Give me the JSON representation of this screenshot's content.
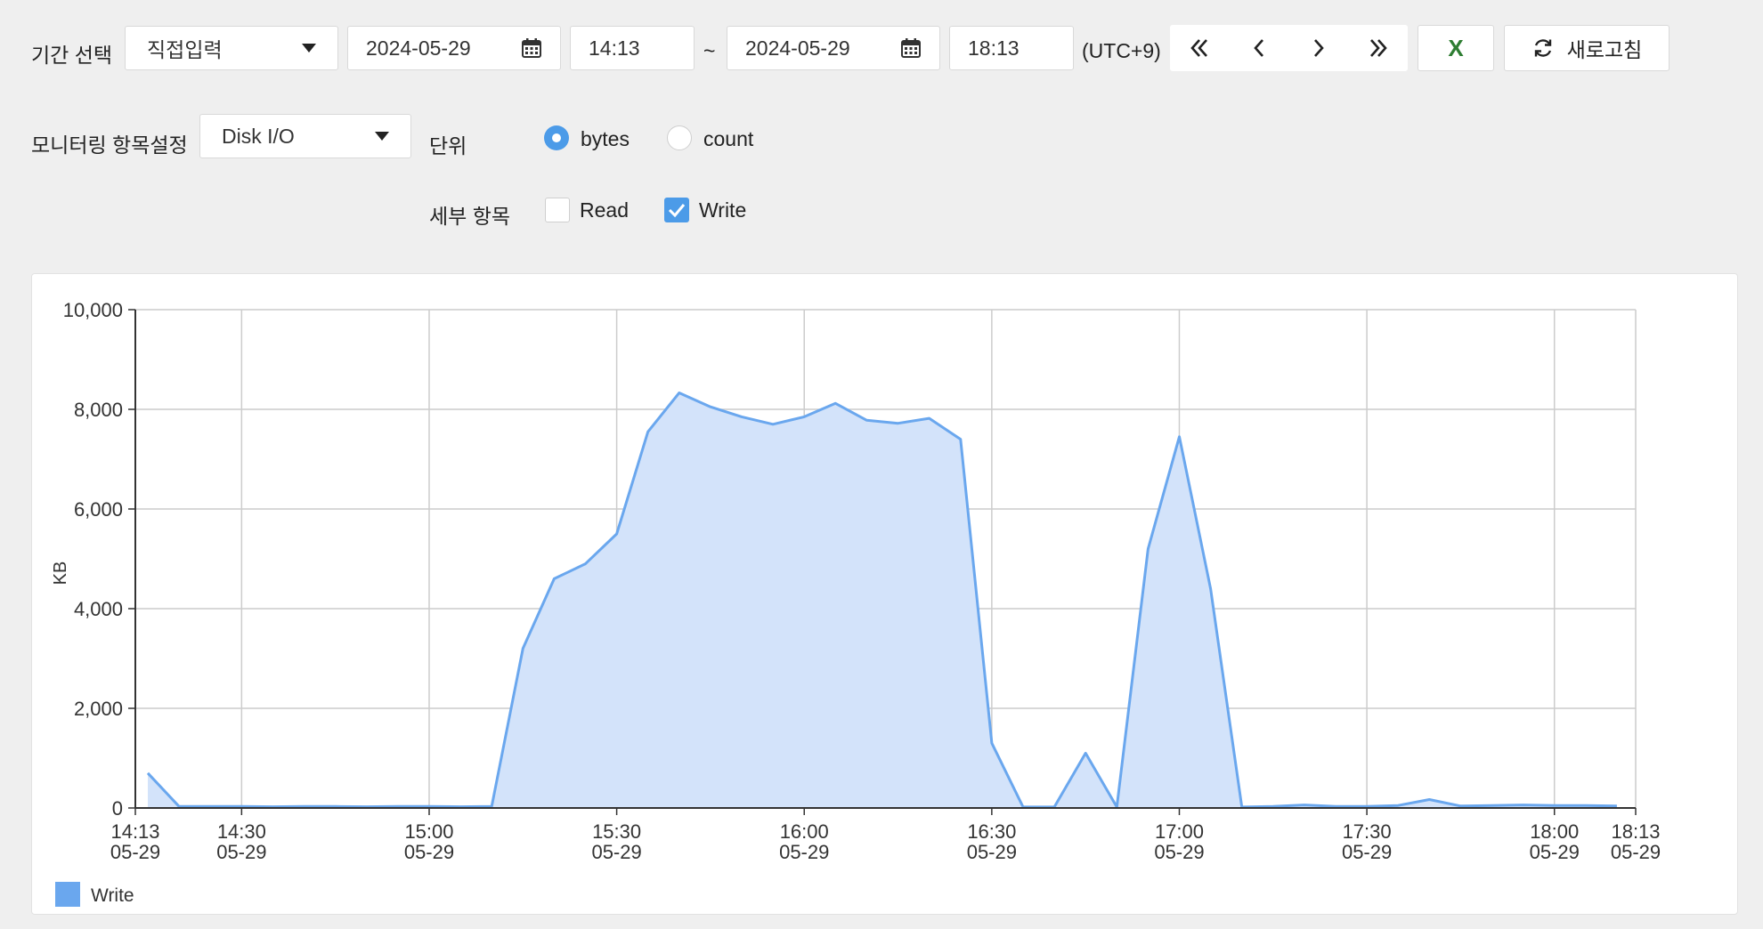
{
  "period": {
    "label": "기간 선택",
    "mode": "직접입력",
    "start_date": "2024-05-29",
    "start_time": "14:13",
    "separator": "~",
    "end_date": "2024-05-29",
    "end_time": "18:13",
    "timezone": "(UTC+9)"
  },
  "nav": [
    "first-icon",
    "prev-icon",
    "next-icon",
    "last-icon"
  ],
  "excel": {
    "label": "X",
    "color": "#2e7d32"
  },
  "refresh": {
    "label": "새로고침",
    "icon": "refresh-icon"
  },
  "monitor": {
    "label": "모니터링 항목설정",
    "item": "Disk I/O",
    "unit_label": "단위",
    "units": [
      {
        "label": "bytes",
        "selected": true
      },
      {
        "label": "count",
        "selected": false
      }
    ],
    "detail_label": "세부 항목",
    "details": [
      {
        "label": "Read",
        "checked": false
      },
      {
        "label": "Write",
        "checked": true
      }
    ]
  },
  "chart_data": {
    "type": "area",
    "ylabel": "KB",
    "ylim": [
      0,
      10000
    ],
    "yticks": [
      "10,000",
      "8,000",
      "6,000",
      "4,000",
      "2,000",
      "0"
    ],
    "ytick_values": [
      10000,
      8000,
      6000,
      4000,
      2000,
      0
    ],
    "xticks": [
      {
        "time": "14:13",
        "date": "05-29",
        "minute": 0
      },
      {
        "time": "14:30",
        "date": "05-29",
        "minute": 17
      },
      {
        "time": "15:00",
        "date": "05-29",
        "minute": 47
      },
      {
        "time": "15:30",
        "date": "05-29",
        "minute": 77
      },
      {
        "time": "16:00",
        "date": "05-29",
        "minute": 107
      },
      {
        "time": "16:30",
        "date": "05-29",
        "minute": 137
      },
      {
        "time": "17:00",
        "date": "05-29",
        "minute": 167
      },
      {
        "time": "17:30",
        "date": "05-29",
        "minute": 197
      },
      {
        "time": "18:00",
        "date": "05-29",
        "minute": 227
      },
      {
        "time": "18:13",
        "date": "05-29",
        "minute": 240
      }
    ],
    "xlim_minutes": [
      0,
      240
    ],
    "grid": true,
    "legend_position": "bottom-left",
    "series": [
      {
        "name": "Write",
        "color": "#6aa7ee",
        "fill": "#d3e3fa",
        "x_minutes": [
          2,
          7,
          12,
          17,
          22,
          27,
          32,
          37,
          42,
          47,
          52,
          57,
          62,
          67,
          72,
          77,
          82,
          87,
          92,
          97,
          102,
          107,
          112,
          117,
          122,
          127,
          132,
          137,
          142,
          147,
          152,
          157,
          162,
          167,
          172,
          177,
          182,
          187,
          192,
          197,
          202,
          207,
          212,
          217,
          222,
          227,
          232,
          237
        ],
        "values": [
          700,
          30,
          30,
          30,
          25,
          30,
          30,
          25,
          30,
          30,
          25,
          30,
          3200,
          4600,
          4900,
          5500,
          7550,
          8330,
          8050,
          7850,
          7700,
          7850,
          8120,
          7780,
          7720,
          7820,
          7400,
          1300,
          20,
          20,
          1100,
          20,
          5200,
          7450,
          4400,
          20,
          30,
          60,
          30,
          30,
          50,
          170,
          40,
          50,
          60,
          50,
          50,
          40
        ]
      }
    ]
  }
}
